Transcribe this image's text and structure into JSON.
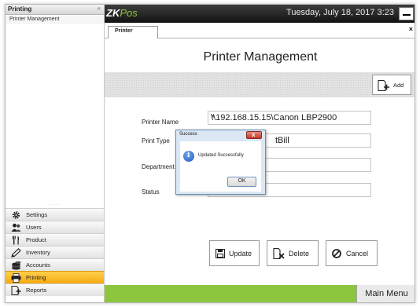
{
  "sidebar": {
    "title": "Printing",
    "collapse_glyph": "«",
    "sub_item": "Printer Management",
    "grip": "·····",
    "items": [
      {
        "label": "Settings",
        "icon": "gear-icon"
      },
      {
        "label": "Users",
        "icon": "users-icon"
      },
      {
        "label": "Product",
        "icon": "cutlery-icon"
      },
      {
        "label": "Inventory",
        "icon": "pencil-icon"
      },
      {
        "label": "Accounts",
        "icon": "coins-icon"
      },
      {
        "label": "Printing",
        "icon": "printer-icon",
        "active": true
      },
      {
        "label": "Reports",
        "icon": "report-icon"
      }
    ]
  },
  "topbar": {
    "logo_prefix": "ZK",
    "logo_suffix": "Pos",
    "datetime": "Tuesday, July 18, 2017 3:23"
  },
  "tab": {
    "label": "Printer",
    "close": "×"
  },
  "page": {
    "title": "Printer Management",
    "add_label": "Add"
  },
  "form": {
    "printer_name": {
      "label": "Printer Name",
      "value": "\\\\192.168.15.15\\Canon LBP2900"
    },
    "print_type": {
      "label": "Print Type",
      "value": "tBill"
    },
    "department": {
      "label": "Department",
      "value": ""
    },
    "status": {
      "label": "Status",
      "value": ""
    }
  },
  "dialog": {
    "title": "Success",
    "close": "x",
    "message": "Updated Successfully",
    "ok": "OK",
    "info_glyph": "i"
  },
  "actions": {
    "update": "Update",
    "delete": "Delete",
    "cancel": "Cancel"
  },
  "footer": {
    "main_menu": "Main Menu"
  },
  "colors": {
    "accent_green": "#8cc63f",
    "active_nav": "#f5a912",
    "topbar": "#1a1a1a"
  }
}
